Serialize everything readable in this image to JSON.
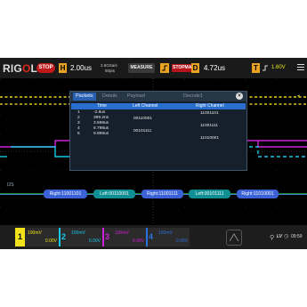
{
  "header": {
    "logo_text": "RIGOL",
    "run_state": "STOP",
    "horizontal_label": "H",
    "timebase": "2.00us",
    "sample_rate": "2.5GSa/s",
    "memory_depth": "50pts",
    "measure_label": "MEASURE",
    "trigger_mode": "STOPMAN",
    "delay_label": "D",
    "delay": "4.72us",
    "trigger_label": "T",
    "trigger_level": "1.60V"
  },
  "decode_dialog": {
    "tabs": [
      "Packets",
      "Details",
      "Payload",
      "Decode1"
    ],
    "active_tab": "Packets",
    "close_label": "×",
    "columns": [
      "Time",
      "Left Channel",
      "Right Channel"
    ],
    "rows": [
      {
        "index": "1",
        "time": "-2.8us",
        "left": "",
        "right": "11001101"
      },
      {
        "index": "2",
        "time": "399.2ns",
        "left": "00110001",
        "right": ""
      },
      {
        "index": "3",
        "time": "3.598us",
        "left": "",
        "right": "11001111"
      },
      {
        "index": "4",
        "time": "6.798us",
        "left": "00101111",
        "right": ""
      },
      {
        "index": "5",
        "time": "9.998us",
        "left": "",
        "right": "11010001"
      }
    ]
  },
  "bus": {
    "label": "I2S",
    "segments": [
      {
        "text": "Right:11001101",
        "kind": "right"
      },
      {
        "text": "Left:00110001",
        "kind": "left"
      },
      {
        "text": "Right:11001111",
        "kind": "right"
      },
      {
        "text": "Left:00101111",
        "kind": "left"
      },
      {
        "text": "Right:11010001",
        "kind": "right"
      }
    ]
  },
  "channels": [
    {
      "num": "1",
      "scale": "100mV",
      "offset": "0.00V",
      "color": "#f2e21b",
      "active": true
    },
    {
      "num": "2",
      "scale": "100mV",
      "offset": "0.00V",
      "color": "#18c8e8",
      "active": false
    },
    {
      "num": "3",
      "scale": "100mV",
      "offset": "0.00V",
      "color": "#d020d8",
      "active": false
    },
    {
      "num": "4",
      "scale": "100mV",
      "offset": "0.00V",
      "color": "#2a72e0",
      "active": false
    }
  ],
  "status": {
    "lv": "LV",
    "time": "09:59"
  },
  "colors": {
    "ch1_trace": "#e8d81b",
    "ch2_trace": "#18c8e8",
    "ch3_trace": "#d020d8",
    "ch4_trace": "#2a72e0",
    "bus_right": "#3a62d6",
    "bus_left": "#0f8f93",
    "stop_red": "#c01818",
    "accent_orange": "#e8a224"
  }
}
